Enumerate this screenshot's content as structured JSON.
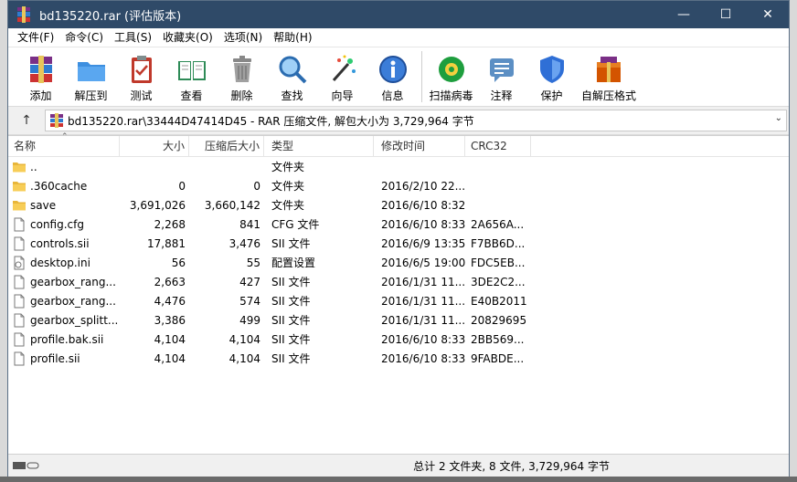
{
  "window": {
    "title": "bd135220.rar (评估版本)"
  },
  "menu": [
    "文件(F)",
    "命令(C)",
    "工具(S)",
    "收藏夹(O)",
    "选项(N)",
    "帮助(H)"
  ],
  "toolbar": {
    "add": "添加",
    "extract": "解压到",
    "test": "测试",
    "view": "查看",
    "delete": "删除",
    "find": "查找",
    "wizard": "向导",
    "info": "信息",
    "scan": "扫描病毒",
    "comment": "注释",
    "protect": "保护",
    "sfx": "自解压格式"
  },
  "pathbar": {
    "text": "bd135220.rar\\33444D47414D45 - RAR 压缩文件, 解包大小为 3,729,964 字节"
  },
  "columns": {
    "name": "名称",
    "size": "大小",
    "packed": "压缩后大小",
    "type": "类型",
    "modified": "修改时间",
    "crc": "CRC32"
  },
  "files": [
    {
      "name": "..",
      "size": "",
      "packed": "",
      "type": "文件夹",
      "modified": "",
      "crc": "",
      "kind": "folder"
    },
    {
      "name": ".360cache",
      "size": "0",
      "packed": "0",
      "type": "文件夹",
      "modified": "2016/2/10 22...",
      "crc": "",
      "kind": "folder"
    },
    {
      "name": "save",
      "size": "3,691,026",
      "packed": "3,660,142",
      "type": "文件夹",
      "modified": "2016/6/10 8:32",
      "crc": "",
      "kind": "folder"
    },
    {
      "name": "config.cfg",
      "size": "2,268",
      "packed": "841",
      "type": "CFG 文件",
      "modified": "2016/6/10 8:33",
      "crc": "2A656A...",
      "kind": "file"
    },
    {
      "name": "controls.sii",
      "size": "17,881",
      "packed": "3,476",
      "type": "SII 文件",
      "modified": "2016/6/9 13:35",
      "crc": "F7BB6D...",
      "kind": "file"
    },
    {
      "name": "desktop.ini",
      "size": "56",
      "packed": "55",
      "type": "配置设置",
      "modified": "2016/6/5 19:00",
      "crc": "FDC5EB...",
      "kind": "ini"
    },
    {
      "name": "gearbox_rang...",
      "size": "2,663",
      "packed": "427",
      "type": "SII 文件",
      "modified": "2016/1/31 11...",
      "crc": "3DE2C2...",
      "kind": "file"
    },
    {
      "name": "gearbox_rang...",
      "size": "4,476",
      "packed": "574",
      "type": "SII 文件",
      "modified": "2016/1/31 11...",
      "crc": "E40B2011",
      "kind": "file"
    },
    {
      "name": "gearbox_splitt...",
      "size": "3,386",
      "packed": "499",
      "type": "SII 文件",
      "modified": "2016/1/31 11...",
      "crc": "20829695",
      "kind": "file"
    },
    {
      "name": "profile.bak.sii",
      "size": "4,104",
      "packed": "4,104",
      "type": "SII 文件",
      "modified": "2016/6/10 8:33",
      "crc": "2BB569...",
      "kind": "file"
    },
    {
      "name": "profile.sii",
      "size": "4,104",
      "packed": "4,104",
      "type": "SII 文件",
      "modified": "2016/6/10 8:33",
      "crc": "9FABDE...",
      "kind": "file"
    }
  ],
  "status": {
    "summary": "总计 2 文件夹, 8 文件, 3,729,964 字节"
  }
}
